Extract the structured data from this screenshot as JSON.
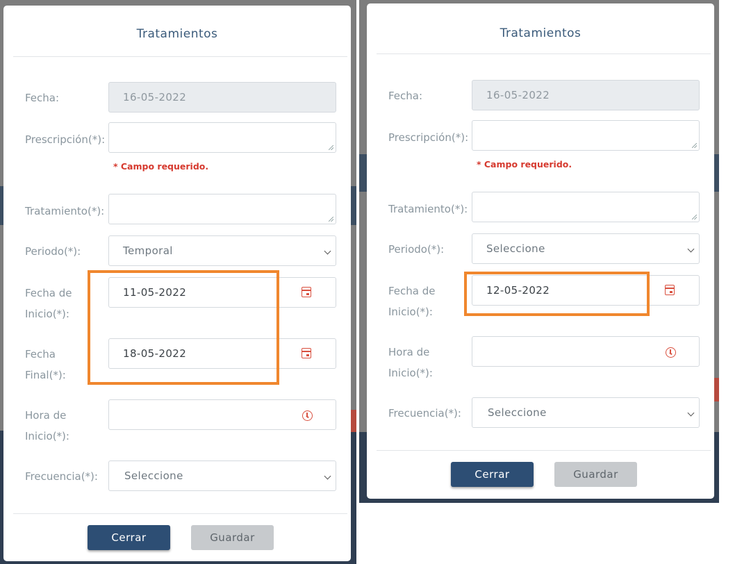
{
  "left_modal": {
    "title": "Tratamientos",
    "fecha": {
      "label": "Fecha:",
      "value": "16-05-2022"
    },
    "prescripcion": {
      "label": "Prescripción(*):",
      "value": ""
    },
    "error": "* Campo requerido.",
    "tratamiento": {
      "label": "Tratamiento(*):",
      "value": ""
    },
    "periodo": {
      "label": "Periodo(*):",
      "value": "Temporal"
    },
    "fecha_inicio": {
      "label": "Fecha de Inicio(*):",
      "value": "11-05-2022"
    },
    "fecha_final": {
      "label": "Fecha Final(*):",
      "value": "18-05-2022"
    },
    "hora_inicio": {
      "label": "Hora de Inicio(*):",
      "value": ""
    },
    "frecuencia": {
      "label": "Frecuencia(*):",
      "value": "Seleccione"
    },
    "close_label": "Cerrar",
    "save_label": "Guardar"
  },
  "right_modal": {
    "title": "Tratamientos",
    "fecha": {
      "label": "Fecha:",
      "value": "16-05-2022"
    },
    "prescripcion": {
      "label": "Prescripción(*):",
      "value": ""
    },
    "error": "* Campo requerido.",
    "tratamiento": {
      "label": "Tratamiento(*):",
      "value": ""
    },
    "periodo": {
      "label": "Periodo(*):",
      "value": "Seleccione"
    },
    "fecha_inicio": {
      "label": "Fecha de Inicio(*):",
      "value": "12-05-2022"
    },
    "hora_inicio": {
      "label": "Hora de Inicio(*):",
      "value": ""
    },
    "frecuencia": {
      "label": "Frecuencia(*):",
      "value": "Seleccione"
    },
    "close_label": "Cerrar",
    "save_label": "Guardar"
  },
  "colors": {
    "primary_button": "#2d4e74",
    "secondary_button": "#c7cacd",
    "error_text": "#d63a2f",
    "highlight": "#f0872e",
    "icon": "#d9503f"
  },
  "icons": [
    "calendar-icon",
    "clock-icon",
    "chevron-down-icon"
  ]
}
